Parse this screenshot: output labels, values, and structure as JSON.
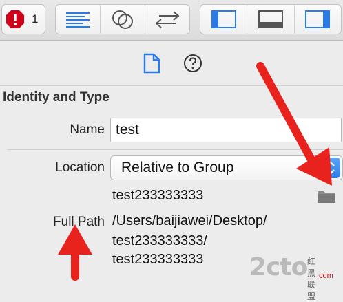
{
  "toolbar": {
    "issue_count": "1",
    "editor_buttons": [
      "standard-editor",
      "assistant-editor",
      "version-editor"
    ],
    "panel_buttons": [
      "navigator-panel",
      "debug-area",
      "utilities-panel"
    ],
    "accent_color": "#2a7be8",
    "error_color": "#d0021b"
  },
  "inspector_tabs": [
    "file-inspector",
    "quick-help"
  ],
  "identity_type": {
    "section_title": "Identity and Type",
    "name_label": "Name",
    "name_value": "test",
    "location_label": "Location",
    "location_value": "Relative to Group",
    "location_path": "test233333333",
    "full_path_label": "Full Path",
    "full_path_lines": [
      "/Users/baijiawei/Desktop/",
      "test233333333/",
      "test233333333"
    ]
  },
  "watermark": {
    "main": "2cto",
    "suffix": ".com",
    "side": "红黑联盟"
  },
  "annotation_color": "#e8231d"
}
